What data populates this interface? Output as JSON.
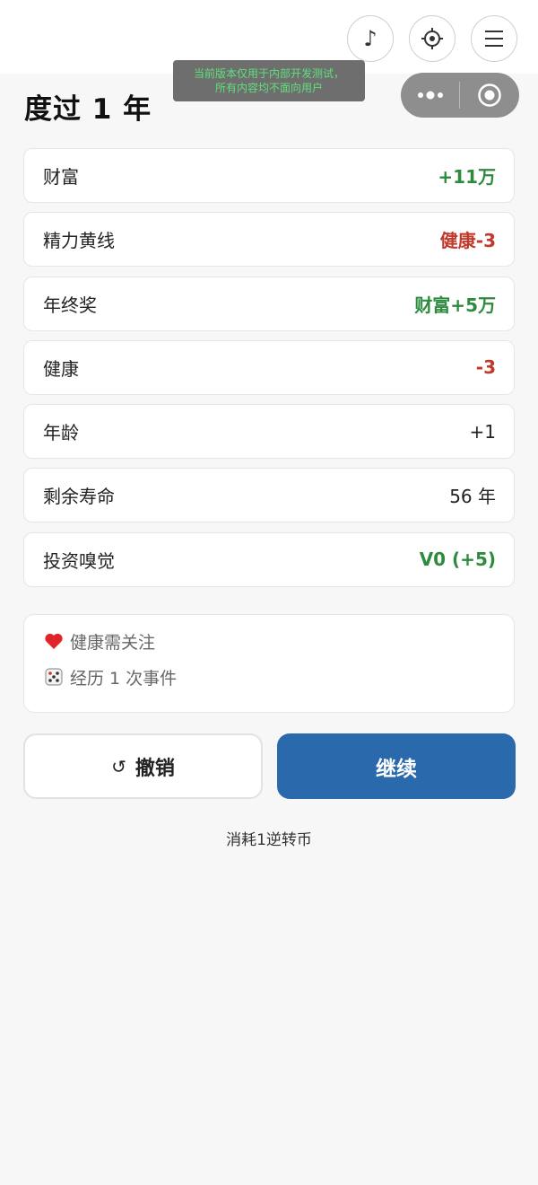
{
  "toast": {
    "line1": "当前版本仅用于内部开发测试，",
    "line2": "所有内容均不面向用户"
  },
  "header": {
    "title": "度过 1 年",
    "icons": [
      "music-note-icon",
      "settings-icon",
      "menu-icon"
    ]
  },
  "results": [
    {
      "label": "财富",
      "value": "+11万",
      "tone": "pos"
    },
    {
      "label": "精力黄线",
      "value": "健康-3",
      "tone": "neg"
    },
    {
      "label": "年终奖",
      "value": "财富+5万",
      "tone": "pos"
    },
    {
      "label": "健康",
      "value": "-3",
      "tone": "neg"
    },
    {
      "label": "年龄",
      "value": "+1",
      "tone": "plain"
    },
    {
      "label": "剩余寿命",
      "value": "56 年",
      "tone": "plain"
    },
    {
      "label": "投资嗅觉",
      "value": "V0 (+5)",
      "tone": "pos"
    }
  ],
  "notes": [
    {
      "icon": "heart-icon",
      "text": "健康需关注"
    },
    {
      "icon": "dice-icon",
      "text": "经历 1 次事件"
    }
  ],
  "actions": {
    "undo_label": "撤销",
    "undo_icon": "↺",
    "continue_label": "继续"
  },
  "footer": {
    "cost_text": "消耗1逆转币"
  },
  "colors": {
    "positive": "#2e8b3e",
    "negative": "#c0392b",
    "primary": "#2a69ac"
  }
}
